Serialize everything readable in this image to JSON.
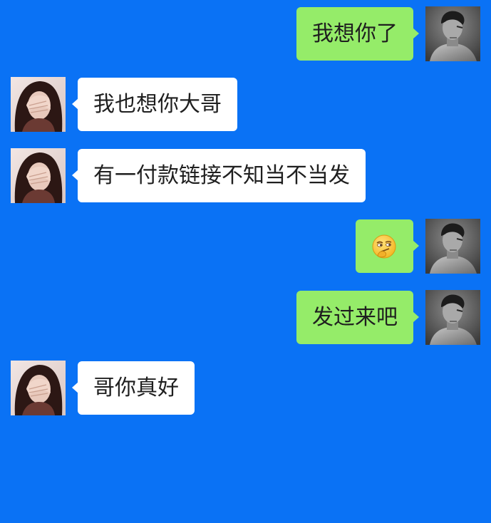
{
  "chat": {
    "messages": [
      {
        "direction": "outgoing",
        "type": "text",
        "text": "我想你了",
        "avatar": "male-portrait-avatar"
      },
      {
        "direction": "incoming",
        "type": "text",
        "text": "我也想你大哥",
        "avatar": "female-face-covered-avatar"
      },
      {
        "direction": "incoming",
        "type": "text",
        "text": "有一付款链接不知当不当发",
        "avatar": "female-face-covered-avatar"
      },
      {
        "direction": "outgoing",
        "type": "emoji",
        "emoji": "thinking-smirk-emoji",
        "avatar": "male-portrait-avatar"
      },
      {
        "direction": "outgoing",
        "type": "text",
        "text": "发过来吧",
        "avatar": "male-portrait-avatar"
      },
      {
        "direction": "incoming",
        "type": "text",
        "text": "哥你真好",
        "avatar": "female-face-covered-avatar"
      }
    ]
  },
  "colors": {
    "background": "#0a72f5",
    "outgoing_bubble": "#95ec69",
    "incoming_bubble": "#ffffff",
    "message_text": "#1f1f1f"
  }
}
